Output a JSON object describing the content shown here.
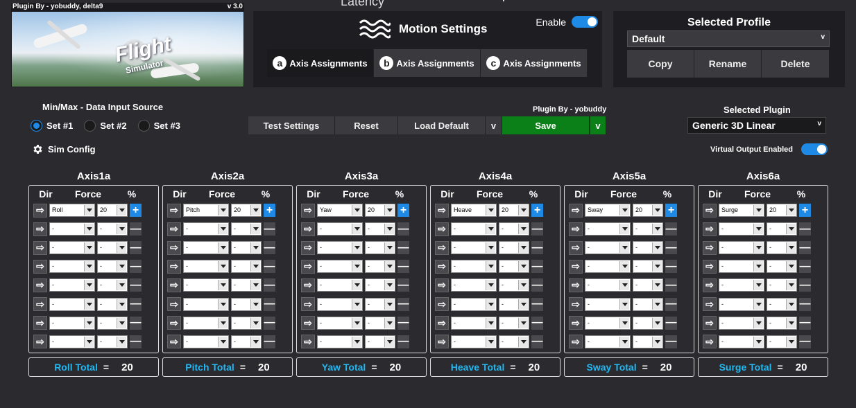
{
  "banner": {
    "credit": "Plugin By - yobuddy, delta9",
    "version": "v 3.0",
    "logo_line1": "Flight",
    "logo_line2": "Simulator"
  },
  "header": {
    "latency": "Latency"
  },
  "motion": {
    "title": "Motion Settings",
    "enable_label": "Enable",
    "tabs": [
      {
        "badge": "a",
        "label": "Axis Assignments"
      },
      {
        "badge": "b",
        "label": "Axis Assignments"
      },
      {
        "badge": "c",
        "label": "Axis Assignments"
      }
    ]
  },
  "profile": {
    "title": "Selected Profile",
    "selected": "Default",
    "copy": "Copy",
    "rename": "Rename",
    "delete": "Delete"
  },
  "source": {
    "title": "Min/Max - Data Input Source",
    "options": [
      "Set #1",
      "Set #2",
      "Set #3"
    ],
    "selected": "Set #1"
  },
  "sim_config": "Sim Config",
  "actions": {
    "test": "Test Settings",
    "reset": "Reset",
    "load_default": "Load Default",
    "save": "Save",
    "plugin_by": "Plugin By - yobuddy",
    "chevron": "v"
  },
  "selected_plugin": {
    "title": "Selected Plugin",
    "value": "Generic 3D Linear"
  },
  "virtual_output": "Virtual Output Enabled",
  "axis_headers": {
    "dir": "Dir",
    "force": "Force",
    "pct": "%"
  },
  "axes": [
    {
      "title": "Axis1a",
      "force": "Roll",
      "pct": "20",
      "total_label": "Roll Total",
      "total_value": "20"
    },
    {
      "title": "Axis2a",
      "force": "Pitch",
      "pct": "20",
      "total_label": "Pitch Total",
      "total_value": "20"
    },
    {
      "title": "Axis3a",
      "force": "Yaw",
      "pct": "20",
      "total_label": "Yaw Total",
      "total_value": "20"
    },
    {
      "title": "Axis4a",
      "force": "Heave",
      "pct": "20",
      "total_label": "Heave Total",
      "total_value": "20"
    },
    {
      "title": "Axis5a",
      "force": "Sway",
      "pct": "20",
      "total_label": "Sway Total",
      "total_value": "20"
    },
    {
      "title": "Axis6a",
      "force": "Surge",
      "pct": "20",
      "total_label": "Surge Total",
      "total_value": "20"
    }
  ],
  "empty_value": "-",
  "equals": "=",
  "colors": {
    "accent": "#1f8ae6",
    "save": "#0b7f18",
    "total_label": "#23b7f2"
  }
}
